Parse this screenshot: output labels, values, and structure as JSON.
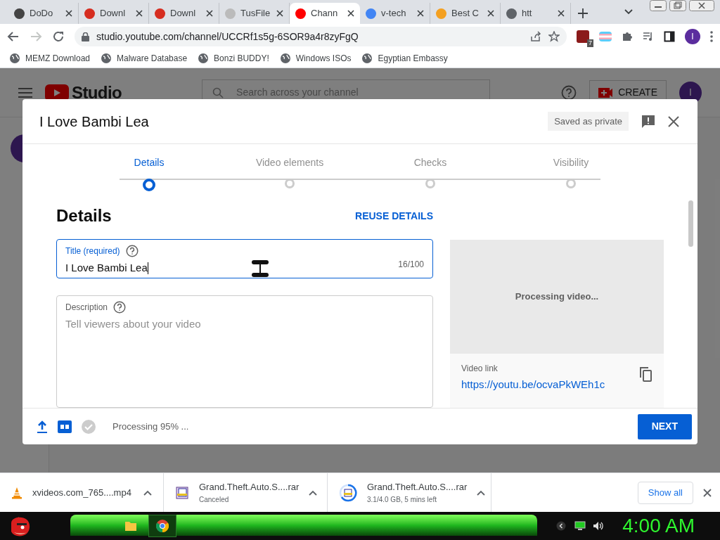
{
  "browser": {
    "tabs": [
      {
        "title": "DoDo",
        "selected": false
      },
      {
        "title": "Downl",
        "selected": false
      },
      {
        "title": "Downl",
        "selected": false
      },
      {
        "title": "TusFile",
        "selected": false
      },
      {
        "title": "Chann",
        "selected": true
      },
      {
        "title": "v-tech",
        "selected": false
      },
      {
        "title": "Best C",
        "selected": false
      },
      {
        "title": "htt",
        "selected": false
      }
    ],
    "address": "studio.youtube.com/channel/UCCRf1s5g-6SOR9a4r8zyFgQ",
    "extension_badge": "7",
    "profile_initial": "I",
    "bookmarks": [
      "MEMZ Download",
      "Malware Database",
      "Bonzi BUDDY!",
      "Windows ISOs",
      "Egyptian Embassy"
    ]
  },
  "studio_header": {
    "logo": "Studio",
    "search_placeholder": "Search across your channel",
    "create": "CREATE",
    "avatar": "I"
  },
  "dialog": {
    "title": "I Love Bambi Lea",
    "saved_status": "Saved as private",
    "steps": [
      {
        "label": "Details",
        "selected": true
      },
      {
        "label": "Video elements",
        "selected": false
      },
      {
        "label": "Checks",
        "selected": false
      },
      {
        "label": "Visibility",
        "selected": false
      }
    ],
    "heading": "Details",
    "reuse": "REUSE DETAILS",
    "title_field": {
      "label": "Title (required)",
      "value": "I Love Bambi Lea",
      "count": "16/100"
    },
    "description_field": {
      "label": "Description",
      "placeholder": "Tell viewers about your video"
    },
    "preview": {
      "status": "Processing video...",
      "link_label": "Video link",
      "link": "https://youtu.be/ocvaPkWEh1c"
    },
    "footer": {
      "progress": "Processing 95% ...",
      "next": "NEXT"
    }
  },
  "downloads": [
    {
      "kind": "video",
      "name": "xvideos.com_765....mp4"
    },
    {
      "kind": "archive",
      "name": "Grand.Theft.Auto.S....rar",
      "status": "Canceled"
    },
    {
      "kind": "archive-progress",
      "name": "Grand.Theft.Auto.S....rar",
      "status": "3.1/4.0 GB, 5 mins left"
    }
  ],
  "show_all": "Show all",
  "taskbar": {
    "clock": "4:00 AM"
  }
}
